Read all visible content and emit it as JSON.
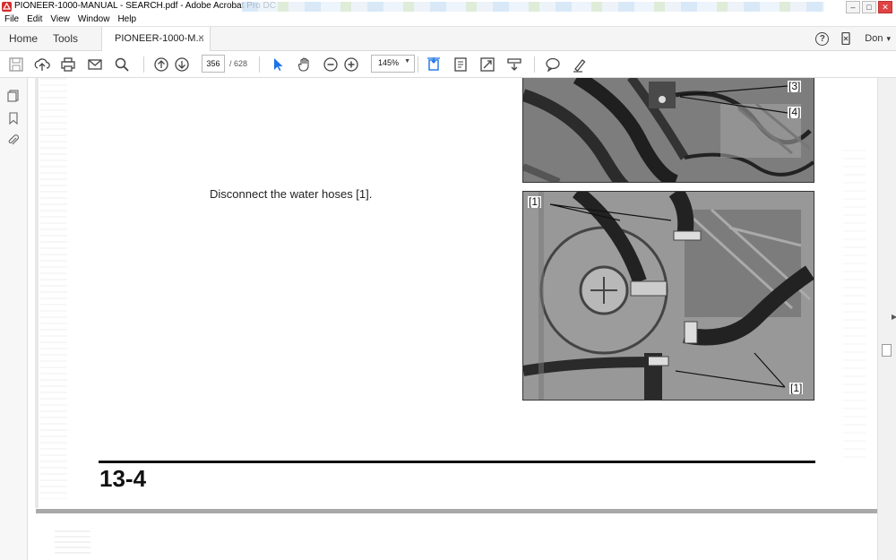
{
  "window": {
    "title": "PIONEER-1000-MANUAL - SEARCH.pdf - Adobe Acrobat Pro DC",
    "controls": {
      "minimize": "–",
      "maximize": "□",
      "close": "✕"
    }
  },
  "menubar": {
    "items": [
      "File",
      "Edit",
      "View",
      "Window",
      "Help"
    ]
  },
  "tabs": {
    "home": "Home",
    "tools": "Tools",
    "document_label": "PIONEER-1000-M...",
    "document_close": "×"
  },
  "account": {
    "help_glyph": "?",
    "user": "Don",
    "chevron": "▾"
  },
  "toolbar": {
    "icons": [
      "save-icon",
      "cloud-upload-icon",
      "print-icon",
      "email-icon",
      "search-icon",
      "page-up-icon",
      "page-down-icon",
      "select-pointer-icon",
      "hand-tool-icon",
      "zoom-out-icon",
      "zoom-in-icon",
      "fit-page-icon",
      "scroll-mode-icon",
      "full-screen-icon",
      "read-mode-icon",
      "comment-icon",
      "highlight-pen-icon"
    ],
    "current_page": "356",
    "page_total": "/ 628",
    "zoom": "145%",
    "zoom_arrow": "▼"
  },
  "document": {
    "instruction": "Disconnect the water hoses [1].",
    "callouts": {
      "top_photo_a": "[3]",
      "top_photo_b": "[4]",
      "bottom_photo_top": "[1]",
      "bottom_photo_bottom": "[1]"
    },
    "page_number": "13-4"
  },
  "colors": {
    "accent_blue": "#1a73e8",
    "page_rule": "#111111"
  }
}
